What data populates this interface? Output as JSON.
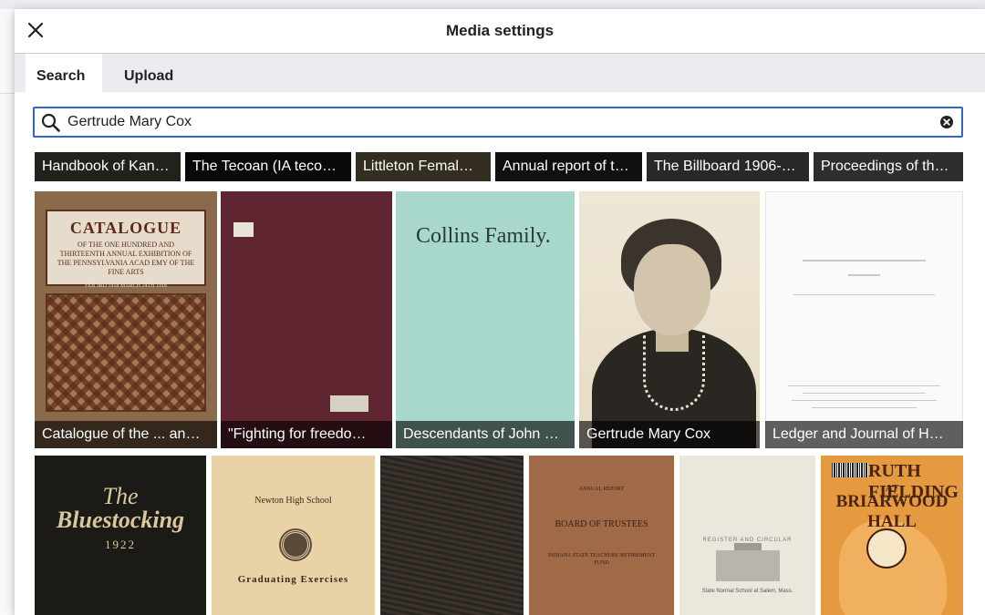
{
  "dialog": {
    "title": "Media settings",
    "close_label": "close-icon"
  },
  "tabs": [
    {
      "label": "Search",
      "active": true
    },
    {
      "label": "Upload",
      "active": false
    }
  ],
  "search": {
    "value": "Gertrude Mary Cox",
    "placeholder": "Search"
  },
  "results": {
    "row0": [
      "Handbook of Kan…",
      "The Tecoan (IA teco…",
      "Littleton Femal…",
      "Annual report of t…",
      "The Billboard 1906-…",
      "Proceedings of th…"
    ],
    "row1": [
      "Catalogue of the ... an…",
      "\"Fighting for freedo…",
      "Descendants of John …",
      "Gertrude Mary Cox",
      "Ledger and Journal of H…"
    ],
    "cover_text": {
      "catalogue_title": "CATALOGUE",
      "catalogue_lines": "OF THE ONE HUNDRED AND THIRTEENTH ANNUAL EXHIBITION OF THE PENNSYLVANIA ACAD EMY OF THE FINE ARTS",
      "catalogue_dates": "FEB 3RD 1918 MARCH 24TH 1918",
      "collins_title": "Collins Family.",
      "bluestocking_1": "The",
      "bluestocking_2": "Bluestocking",
      "bluestocking_3": "1922",
      "newton_1": "Newton High School",
      "newton_2": "Graduating Exercises",
      "trustees_1": "ANNUAL REPORT",
      "trustees_2": "BOARD OF TRUSTEES",
      "trustees_3": "INDIANA STATE TEACHERS' RETIREMENT FUND",
      "engraving_1": "REGISTER AND CIRCULAR",
      "engraving_2": "State Normal School at Salem, Mass.",
      "ruth_1": "RUTH FIELDING",
      "ruth_2": "AT",
      "ruth_3": "BRIARWOOD HALL"
    }
  },
  "colors": {
    "accent": "#3366cc",
    "tab_bar": "#eaecf0",
    "caption_bg": "rgba(0,0,0,0.62)"
  }
}
